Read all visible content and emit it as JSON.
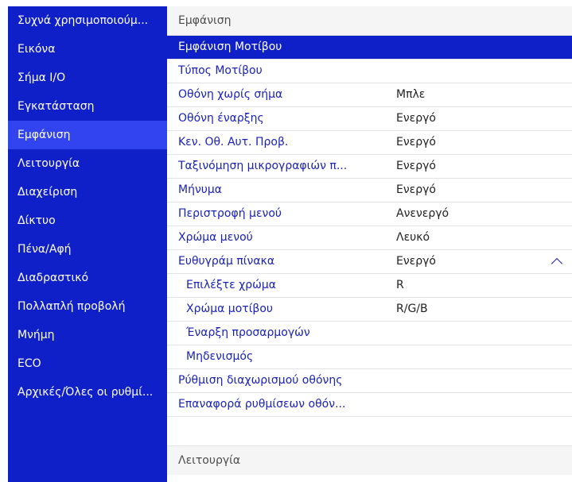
{
  "sidebar": {
    "items": [
      {
        "label": "Συχνά χρησιμοποιούμ..."
      },
      {
        "label": "Εικόνα"
      },
      {
        "label": "Σήμα I/O"
      },
      {
        "label": "Εγκατάσταση"
      },
      {
        "label": "Εμφάνιση",
        "active": true
      },
      {
        "label": "Λειτουργία"
      },
      {
        "label": "Διαχείριση"
      },
      {
        "label": "Δίκτυο"
      },
      {
        "label": "Πένα/Αφή"
      },
      {
        "label": "Διαδραστικό"
      },
      {
        "label": "Πολλαπλή προβολή"
      },
      {
        "label": "Μνήμη"
      },
      {
        "label": "ECO"
      },
      {
        "label": "Αρχικές/Όλες οι ρυθμί..."
      }
    ]
  },
  "main": {
    "section_title": "Εμφάνιση",
    "next_section_title": "Λειτουργία",
    "rows": [
      {
        "label": "Εμφάνιση Μοτίβου",
        "value": ""
      },
      {
        "label": "Τύπος Μοτίβου",
        "value": ""
      },
      {
        "label": "Οθόνη χωρίς σήμα",
        "value": "Μπλε"
      },
      {
        "label": "Οθόνη έναρξης",
        "value": "Ενεργό"
      },
      {
        "label": "Κεν. Οθ. Αυτ. Προβ.",
        "value": "Ενεργό"
      },
      {
        "label": "Ταξινόμηση μικρογραφιών π...",
        "value": "Ενεργό"
      },
      {
        "label": "Μήνυμα",
        "value": "Ενεργό"
      },
      {
        "label": "Περιστροφή μενού",
        "value": "Ανενεργό"
      },
      {
        "label": "Χρώμα μενού",
        "value": "Λευκό"
      },
      {
        "label": "Ευθυγράμ πίνακα",
        "value": "Ενεργό"
      },
      {
        "label": "Επιλέξτε χρώμα",
        "value": "R"
      },
      {
        "label": "Χρώμα μοτίβου",
        "value": "R/G/B"
      },
      {
        "label": "Έναρξη προσαρμογών",
        "value": ""
      },
      {
        "label": "Μηδενισμός",
        "value": ""
      },
      {
        "label": "Ρύθμιση διαχωρισμού οθόνης",
        "value": ""
      },
      {
        "label": "Επαναφορά ρυθμίσεων οθόν...",
        "value": ""
      }
    ]
  },
  "colors": {
    "sidebar_bg": "#1020c8",
    "sidebar_active": "#3144f0",
    "selection": "#1020c8",
    "label_text": "#1a22b8"
  }
}
